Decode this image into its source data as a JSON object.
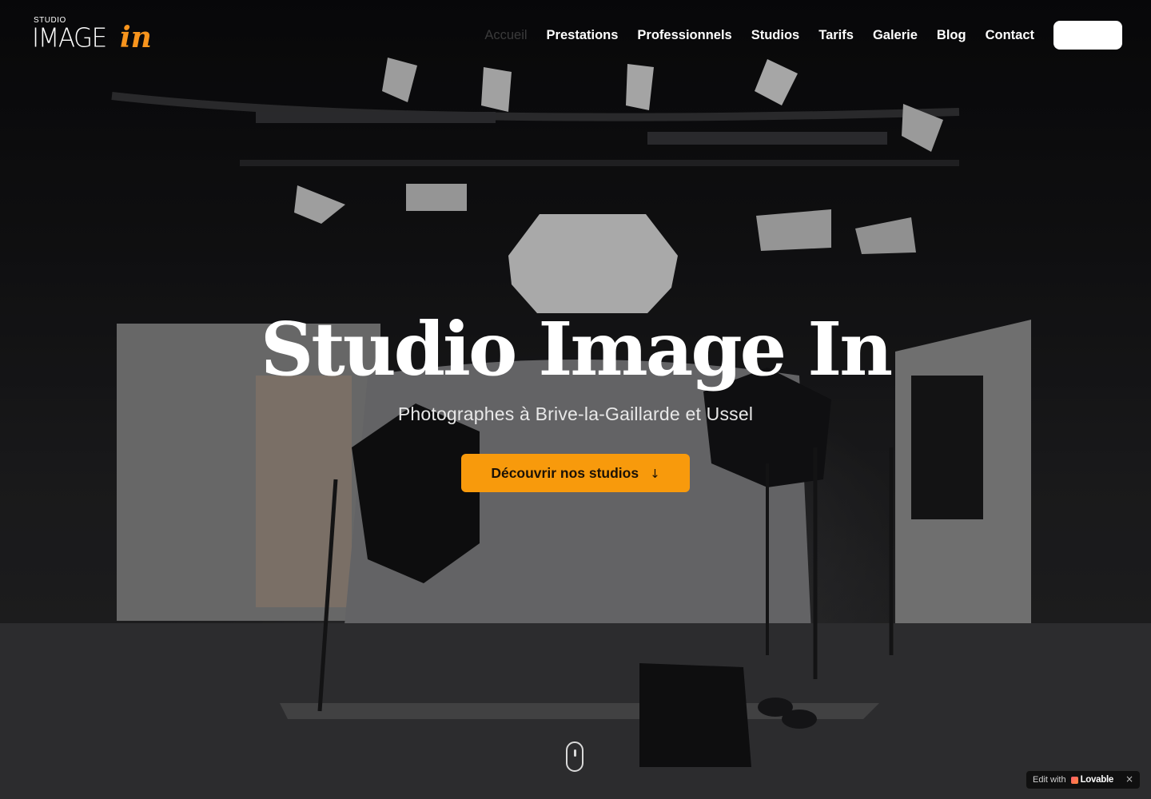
{
  "header": {
    "logo": {
      "small_text": "STUDIO",
      "main_text": "IMAGE",
      "accent_text": "in"
    },
    "menu": [
      {
        "label": "Accueil",
        "muted": true
      },
      {
        "label": "Prestations"
      },
      {
        "label": "Professionnels"
      },
      {
        "label": "Studios"
      },
      {
        "label": "Tarifs"
      },
      {
        "label": "Galerie"
      },
      {
        "label": "Blog"
      },
      {
        "label": "Contact"
      }
    ],
    "cta_label": ""
  },
  "hero": {
    "title": "Studio Image In",
    "subtitle": "Photographes à Brive-la-Gaillarde et Ussel",
    "cta_label": "Découvrir nos studios",
    "cta_icon": "arrow-down-icon"
  },
  "scroll_indicator_icon": "mouse-icon",
  "badge": {
    "edit_text": "Edit with",
    "brand": "Lovable",
    "close": "×"
  },
  "colors": {
    "accent": "#f7941d",
    "cta_background": "#f89a0c",
    "text_primary": "#ffffff"
  }
}
